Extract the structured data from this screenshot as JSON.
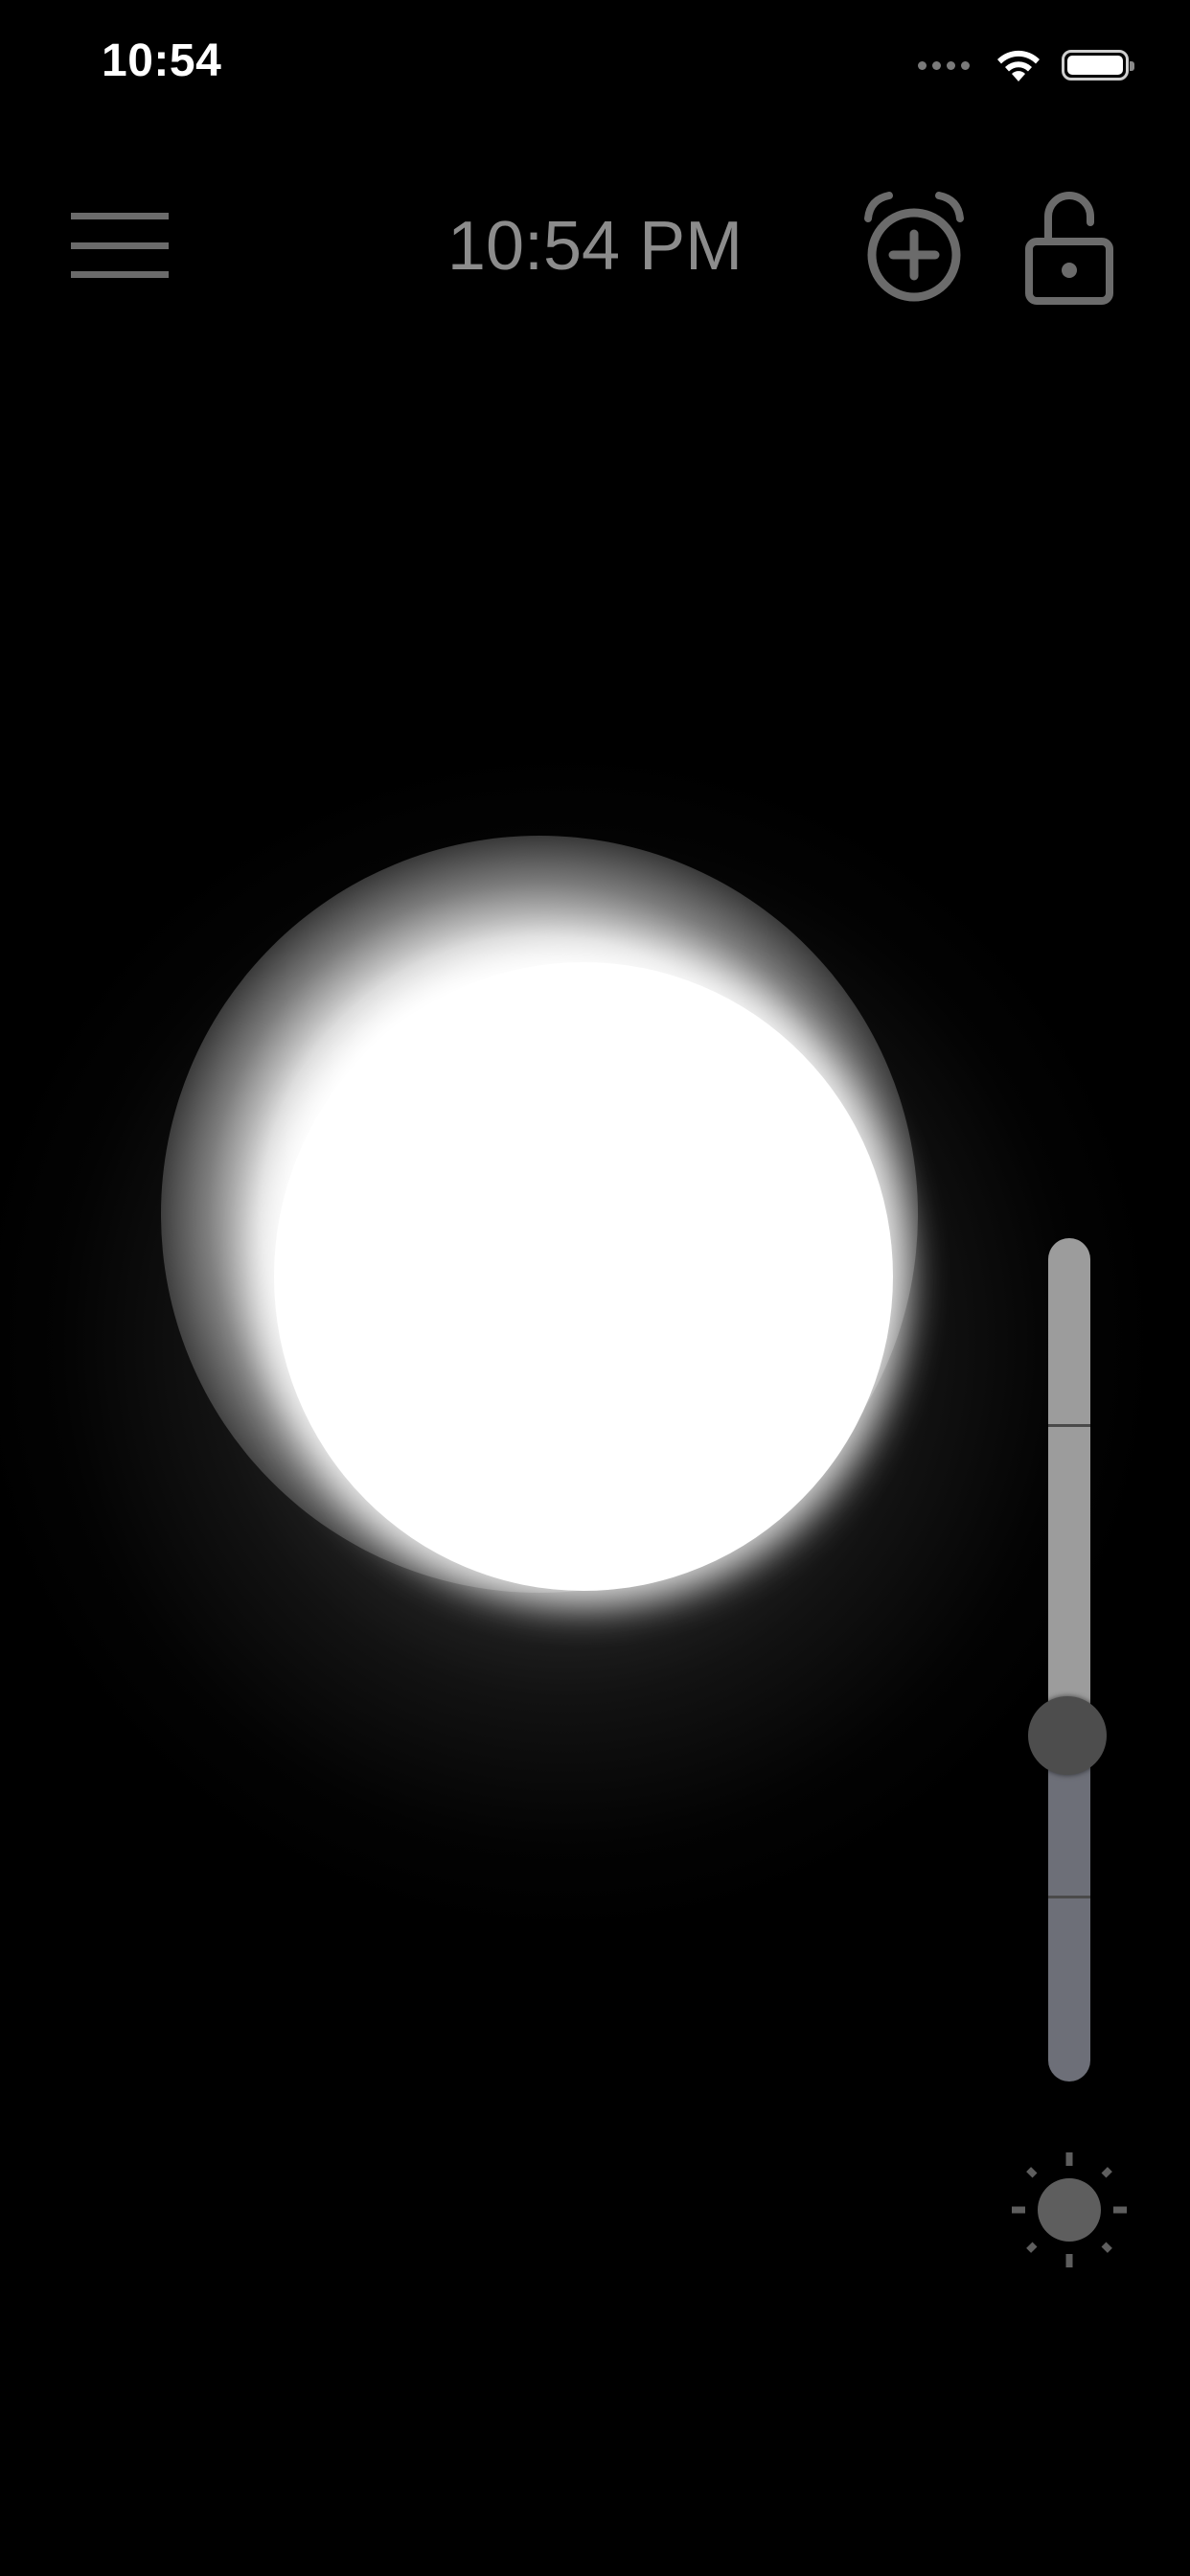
{
  "status_bar": {
    "time": "10:54",
    "icons": [
      "cellular-signal-icon",
      "wifi-icon",
      "battery-icon"
    ]
  },
  "toolbar": {
    "time": "10:54 PM",
    "menu_icon": "hamburger-menu-icon",
    "alarm_icon": "alarm-add-icon",
    "lock_icon": "unlocked-padlock-icon"
  },
  "light": {
    "color": "#ffffff"
  },
  "brightness": {
    "level": 0.41,
    "tick_levels": [
      0.22,
      0.405,
      0.78
    ],
    "icon": "sun-icon",
    "upper_color": "#9c9c9c",
    "lower_color": "#6d6f78"
  }
}
